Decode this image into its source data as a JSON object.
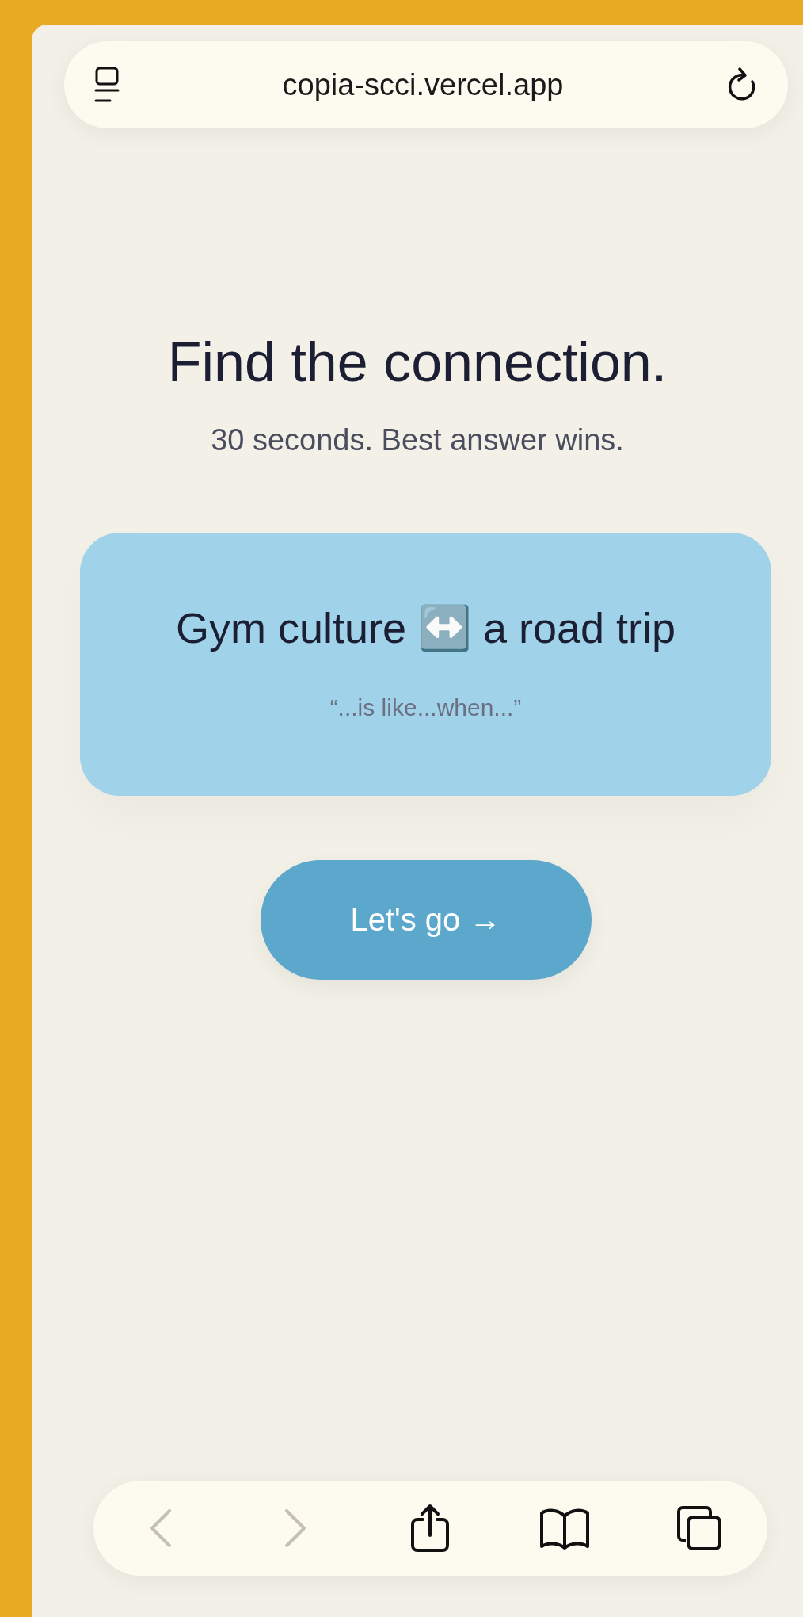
{
  "address_bar": {
    "url": "copia-scci.vercel.app"
  },
  "heading": "Find the connection.",
  "subheading": "30 seconds. Best answer wins.",
  "prompt_card": {
    "title": "Gym culture ↔️ a road trip",
    "hint": "“...is like...when...”"
  },
  "start_button": "Let's go →",
  "toolbar": [
    {
      "kind": "back",
      "disabled": true
    },
    {
      "kind": "forward",
      "disabled": true
    },
    {
      "kind": "share",
      "disabled": false
    },
    {
      "kind": "bookmarks",
      "disabled": false
    },
    {
      "kind": "tabs",
      "disabled": false
    }
  ]
}
